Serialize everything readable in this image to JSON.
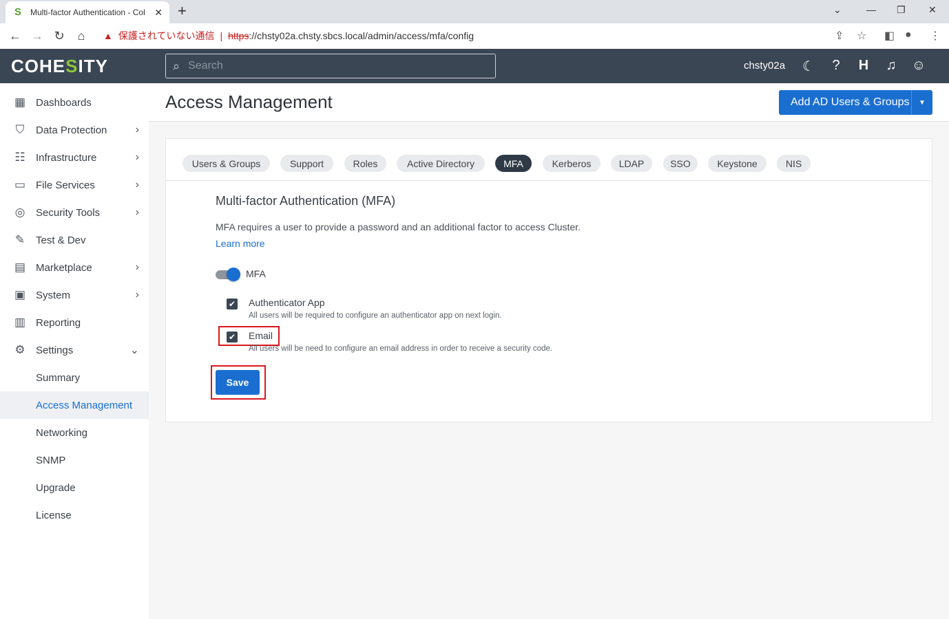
{
  "browser": {
    "tab_title": "Multi-factor Authentication - Col",
    "tab_close": "✕",
    "new_tab": "+",
    "insecure_label": "保護されていない通信",
    "url_protocol": "https",
    "url_rest": "://chsty02a.chsty.sbcs.local/admin/access/mfa/config"
  },
  "header": {
    "logo_a": "COHE",
    "logo_b": "S",
    "logo_c": "ITY",
    "search_placeholder": "Search",
    "cluster_name": "chsty02a"
  },
  "sidebar": {
    "items": [
      {
        "label": "Dashboards",
        "icon": "dashboard-icon"
      },
      {
        "label": "Data Protection",
        "icon": "shield-icon"
      },
      {
        "label": "Infrastructure",
        "icon": "infrastructure-icon"
      },
      {
        "label": "File Services",
        "icon": "folder-icon"
      },
      {
        "label": "Security Tools",
        "icon": "fingerprint-icon"
      },
      {
        "label": "Test & Dev",
        "icon": "wrench-icon"
      },
      {
        "label": "Marketplace",
        "icon": "store-icon"
      },
      {
        "label": "System",
        "icon": "system-icon"
      },
      {
        "label": "Reporting",
        "icon": "reporting-icon"
      },
      {
        "label": "Settings",
        "icon": "gear-icon"
      }
    ],
    "settings_sub": [
      "Summary",
      "Access Management",
      "Networking",
      "SNMP",
      "Upgrade",
      "License"
    ]
  },
  "page": {
    "title": "Access Management",
    "add_button": "Add AD Users & Groups"
  },
  "tabs": [
    "Users & Groups",
    "Support",
    "Roles",
    "Active Directory",
    "MFA",
    "Kerberos",
    "LDAP",
    "SSO",
    "Keystone",
    "NIS"
  ],
  "mfa": {
    "title": "Multi-factor Authentication (MFA)",
    "description": "MFA requires a user to provide a password and an additional factor to access Cluster.",
    "learn_more": "Learn more",
    "toggle_label": "MFA",
    "toggle_on": true,
    "authenticator_label": "Authenticator App",
    "authenticator_hint": "All users will be required to configure an authenticator app on next login.",
    "email_label": "Email",
    "email_hint": "All users will be need to configure an email address in order to receive a security code.",
    "save": "Save"
  },
  "colors": {
    "primary": "#1a6ed0",
    "header_bg": "#3a4654",
    "highlight": "#d9161e",
    "logo_accent": "#8dc63f"
  }
}
